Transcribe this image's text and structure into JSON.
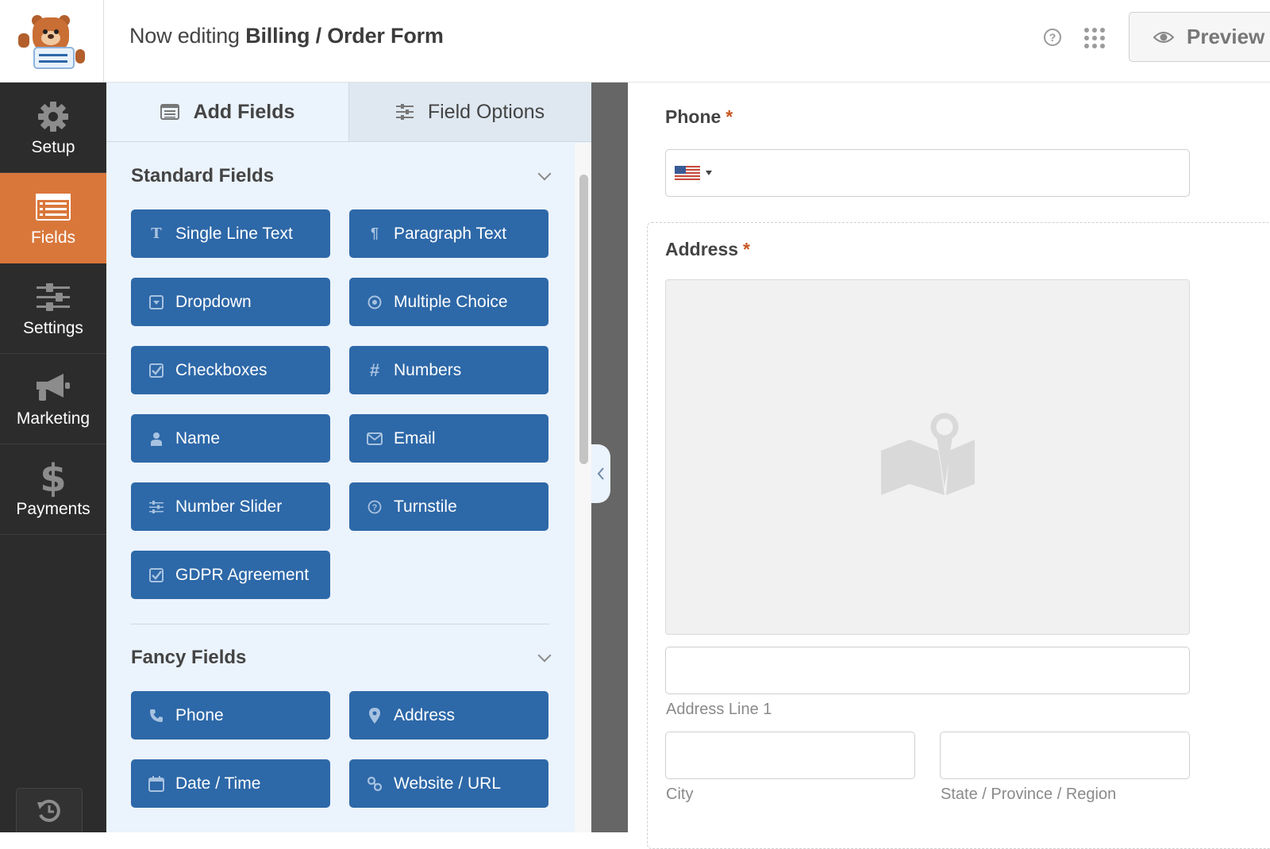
{
  "header": {
    "title_prefix": "Now editing",
    "form_name": "Billing / Order Form",
    "help_icon": "question-circle-icon",
    "apps_icon": "grid-dots-icon",
    "preview_label": "Preview",
    "preview_icon": "eye-icon"
  },
  "leftnav": {
    "items": [
      {
        "label": "Setup",
        "icon": "gear-icon",
        "active": false
      },
      {
        "label": "Fields",
        "icon": "list-form-icon",
        "active": true
      },
      {
        "label": "Settings",
        "icon": "sliders-icon",
        "active": false
      },
      {
        "label": "Marketing",
        "icon": "megaphone-icon",
        "active": false
      },
      {
        "label": "Payments",
        "icon": "dollar-icon",
        "active": false
      }
    ],
    "history_icon": "history-icon"
  },
  "panel": {
    "tabs": [
      {
        "label": "Add Fields",
        "icon": "list-icon",
        "active": true
      },
      {
        "label": "Field Options",
        "icon": "sliders-icon",
        "active": false
      }
    ],
    "sections": [
      {
        "title": "Standard Fields",
        "buttons": [
          {
            "label": "Single Line Text",
            "icon": "text-icon"
          },
          {
            "label": "Paragraph Text",
            "icon": "paragraph-icon"
          },
          {
            "label": "Dropdown",
            "icon": "dropdown-icon"
          },
          {
            "label": "Multiple Choice",
            "icon": "radio-icon"
          },
          {
            "label": "Checkboxes",
            "icon": "checkbox-icon"
          },
          {
            "label": "Numbers",
            "icon": "hash-icon"
          },
          {
            "label": "Name",
            "icon": "user-icon"
          },
          {
            "label": "Email",
            "icon": "envelope-icon"
          },
          {
            "label": "Number Slider",
            "icon": "sliders-icon"
          },
          {
            "label": "Turnstile",
            "icon": "question-circle-icon"
          },
          {
            "label": "GDPR Agreement",
            "icon": "checkbox-icon"
          }
        ]
      },
      {
        "title": "Fancy Fields",
        "buttons": [
          {
            "label": "Phone",
            "icon": "phone-icon"
          },
          {
            "label": "Address",
            "icon": "map-marker-icon"
          },
          {
            "label": "Date / Time",
            "icon": "calendar-icon"
          },
          {
            "label": "Website / URL",
            "icon": "link-icon"
          }
        ]
      }
    ]
  },
  "form": {
    "phone": {
      "label": "Phone",
      "required_mark": "*",
      "country": "US",
      "value": ""
    },
    "address": {
      "label": "Address",
      "required_mark": "*",
      "map_icon": "map-pin-icon",
      "line1_label": "Address Line 1",
      "city_label": "City",
      "state_label": "State / Province / Region"
    }
  },
  "colors": {
    "accent_orange": "#d9773b",
    "button_blue": "#2d68a8",
    "required_red": "#c8561f"
  }
}
